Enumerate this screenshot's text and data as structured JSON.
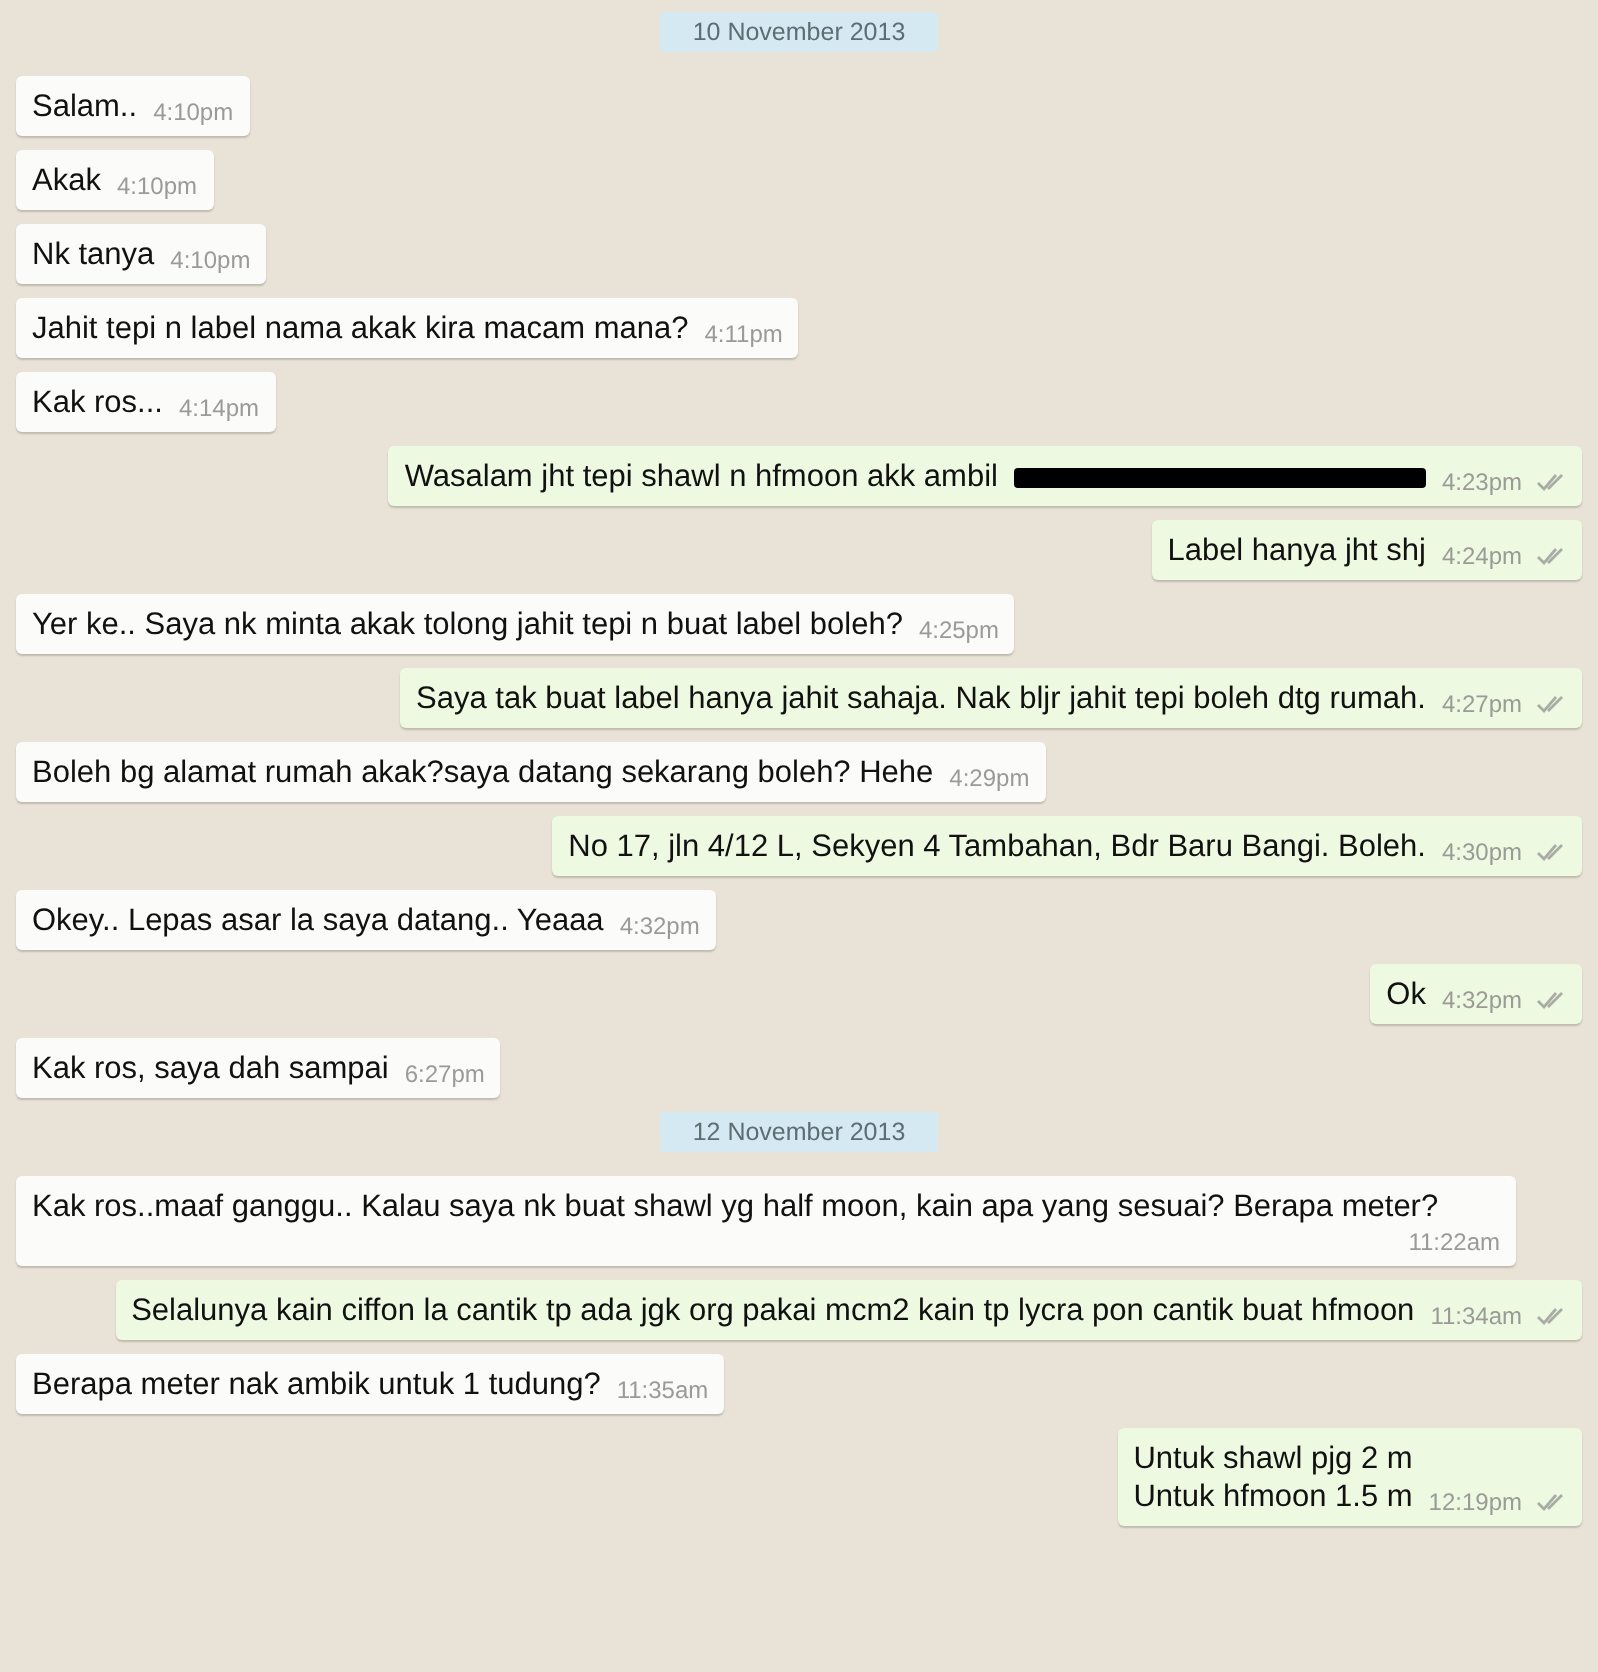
{
  "items": [
    {
      "kind": "date",
      "text": "10 November 2013"
    },
    {
      "kind": "message",
      "outgoing": false,
      "text": "Salam..",
      "time": "4:10pm",
      "redacted": false
    },
    {
      "kind": "message",
      "outgoing": false,
      "text": "Akak",
      "time": "4:10pm",
      "redacted": false
    },
    {
      "kind": "message",
      "outgoing": false,
      "text": "Nk tanya",
      "time": "4:10pm",
      "redacted": false
    },
    {
      "kind": "message",
      "outgoing": false,
      "text": "Jahit tepi n label nama akak kira macam mana?",
      "time": "4:11pm",
      "redacted": false
    },
    {
      "kind": "message",
      "outgoing": false,
      "text": "Kak ros...",
      "time": "4:14pm",
      "redacted": false
    },
    {
      "kind": "message",
      "outgoing": true,
      "text": "Wasalam jht tepi shawl n hfmoon akk ambil",
      "time": "4:23pm",
      "redacted": true,
      "double_tick": true
    },
    {
      "kind": "message",
      "outgoing": true,
      "text": "Label hanya jht shj",
      "time": "4:24pm",
      "redacted": false,
      "double_tick": true
    },
    {
      "kind": "message",
      "outgoing": false,
      "text": "Yer ke.. Saya nk minta akak tolong jahit tepi n buat label boleh?",
      "time": "4:25pm",
      "redacted": false
    },
    {
      "kind": "message",
      "outgoing": true,
      "text": "Saya tak buat label hanya jahit sahaja. Nak bljr jahit tepi boleh dtg rumah.",
      "time": "4:27pm",
      "redacted": false,
      "double_tick": true
    },
    {
      "kind": "message",
      "outgoing": false,
      "text": "Boleh bg alamat rumah akak?saya datang sekarang boleh? Hehe",
      "time": "4:29pm",
      "redacted": false
    },
    {
      "kind": "message",
      "outgoing": true,
      "text": "No 17, jln 4/12 L, Sekyen 4 Tambahan, Bdr Baru Bangi. Boleh.",
      "time": "4:30pm",
      "redacted": false,
      "double_tick": true
    },
    {
      "kind": "message",
      "outgoing": false,
      "text": "Okey.. Lepas asar la saya datang.. Yeaaa",
      "time": "4:32pm",
      "redacted": false
    },
    {
      "kind": "message",
      "outgoing": true,
      "text": "Ok",
      "time": "4:32pm",
      "redacted": false,
      "double_tick": true
    },
    {
      "kind": "message",
      "outgoing": false,
      "text": "Kak ros, saya dah sampai",
      "time": "6:27pm",
      "redacted": false
    },
    {
      "kind": "date",
      "text": "12 November 2013"
    },
    {
      "kind": "message",
      "outgoing": false,
      "text": "Kak ros..maaf ganggu.. Kalau saya nk buat shawl yg half moon, kain apa yang sesuai? Berapa meter?",
      "time": "11:22am",
      "redacted": false
    },
    {
      "kind": "message",
      "outgoing": true,
      "text": "Selalunya kain ciffon la cantik tp ada jgk org pakai mcm2 kain tp lycra pon cantik buat hfmoon",
      "time": "11:34am",
      "redacted": false,
      "double_tick": true
    },
    {
      "kind": "message",
      "outgoing": false,
      "text": "Berapa meter nak ambik untuk 1 tudung?",
      "time": "11:35am",
      "redacted": false
    },
    {
      "kind": "message",
      "outgoing": true,
      "text": "Untuk shawl pjg 2 m\nUntuk hfmoon 1.5 m",
      "time": "12:19pm",
      "redacted": false,
      "double_tick": true
    }
  ]
}
